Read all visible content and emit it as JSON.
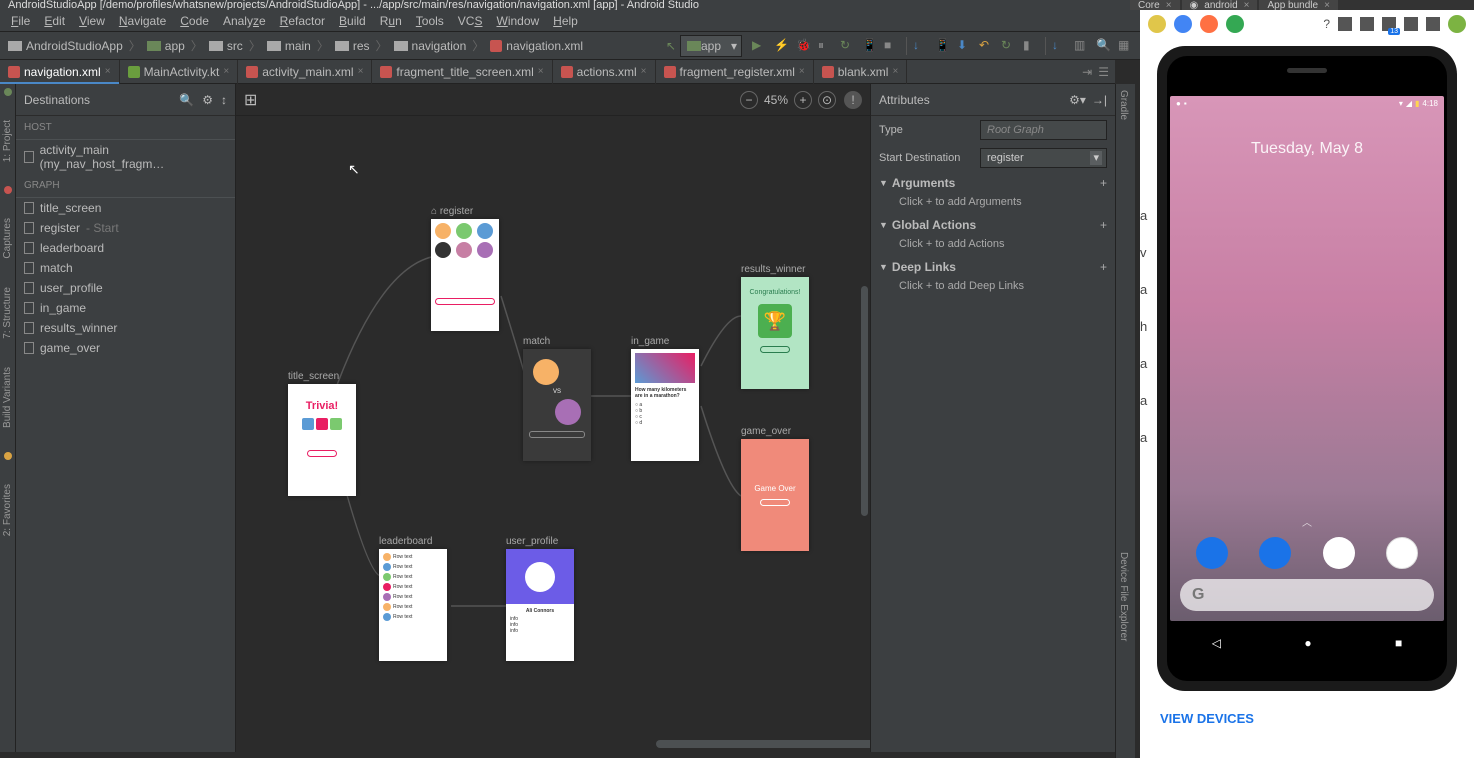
{
  "window_title": "AndroidStudioApp [/demo/profiles/whatsnew/projects/AndroidStudioApp] - .../app/src/main/res/navigation/navigation.xml [app] - Android Studio",
  "browser_tabs": [
    {
      "label": "Core"
    },
    {
      "label": "android"
    },
    {
      "label": "App bundle"
    }
  ],
  "menu": {
    "file": "File",
    "edit": "Edit",
    "view": "View",
    "navigate": "Navigate",
    "code": "Code",
    "analyze": "Analyze",
    "refactor": "Refactor",
    "build": "Build",
    "run": "Run",
    "tools": "Tools",
    "vcs": "VCS",
    "window": "Window",
    "help": "Help"
  },
  "breadcrumbs": [
    "AndroidStudioApp",
    "app",
    "src",
    "main",
    "res",
    "navigation",
    "navigation.xml"
  ],
  "module_selector": "app",
  "file_tabs": [
    {
      "name": "navigation.xml",
      "active": true,
      "type": "xml"
    },
    {
      "name": "MainActivity.kt",
      "active": false,
      "type": "kt"
    },
    {
      "name": "activity_main.xml",
      "active": false,
      "type": "xml"
    },
    {
      "name": "fragment_title_screen.xml",
      "active": false,
      "type": "xml"
    },
    {
      "name": "actions.xml",
      "active": false,
      "type": "xml"
    },
    {
      "name": "fragment_register.xml",
      "active": false,
      "type": "xml"
    },
    {
      "name": "blank.xml",
      "active": false,
      "type": "xml"
    }
  ],
  "destinations": {
    "title": "Destinations",
    "host_label": "HOST",
    "host_item": "activity_main (my_nav_host_fragm…",
    "graph_label": "GRAPH",
    "items": [
      {
        "name": "title_screen"
      },
      {
        "name": "register",
        "suffix": " - Start"
      },
      {
        "name": "leaderboard"
      },
      {
        "name": "match"
      },
      {
        "name": "user_profile"
      },
      {
        "name": "in_game"
      },
      {
        "name": "results_winner"
      },
      {
        "name": "game_over"
      }
    ]
  },
  "zoom": "45%",
  "canvas_nodes": {
    "register": "register",
    "title_screen": "title_screen",
    "match": "match",
    "in_game": "in_game",
    "results_winner": "results_winner",
    "game_over": "game_over",
    "leaderboard": "leaderboard",
    "user_profile": "user_profile"
  },
  "node_content": {
    "title_screen_title": "Trivia!",
    "results_congrats": "Congratulations!",
    "game_over_text": "Game Over",
    "user_profile_name": "Ali Connors",
    "match_vs": "VS",
    "in_game_q": "How many kilometers are in a marathon?"
  },
  "attributes": {
    "title": "Attributes",
    "type_label": "Type",
    "type_value": "Root Graph",
    "start_dest_label": "Start Destination",
    "start_dest_value": "register",
    "sections": {
      "arguments": {
        "label": "Arguments",
        "hint": "Click + to add Arguments"
      },
      "global_actions": {
        "label": "Global Actions",
        "hint": "Click + to add Actions"
      },
      "deep_links": {
        "label": "Deep Links",
        "hint": "Click + to add Deep Links"
      }
    }
  },
  "right_rail": {
    "gradle": "Gradle",
    "device": "Device File Explorer"
  },
  "phone": {
    "time": "4:18",
    "date": "Tuesday, May 8"
  },
  "view_devices": "VIEW DEVICES",
  "side_letters": [
    "a",
    "v",
    "a",
    "h",
    "a",
    "a",
    "a"
  ]
}
